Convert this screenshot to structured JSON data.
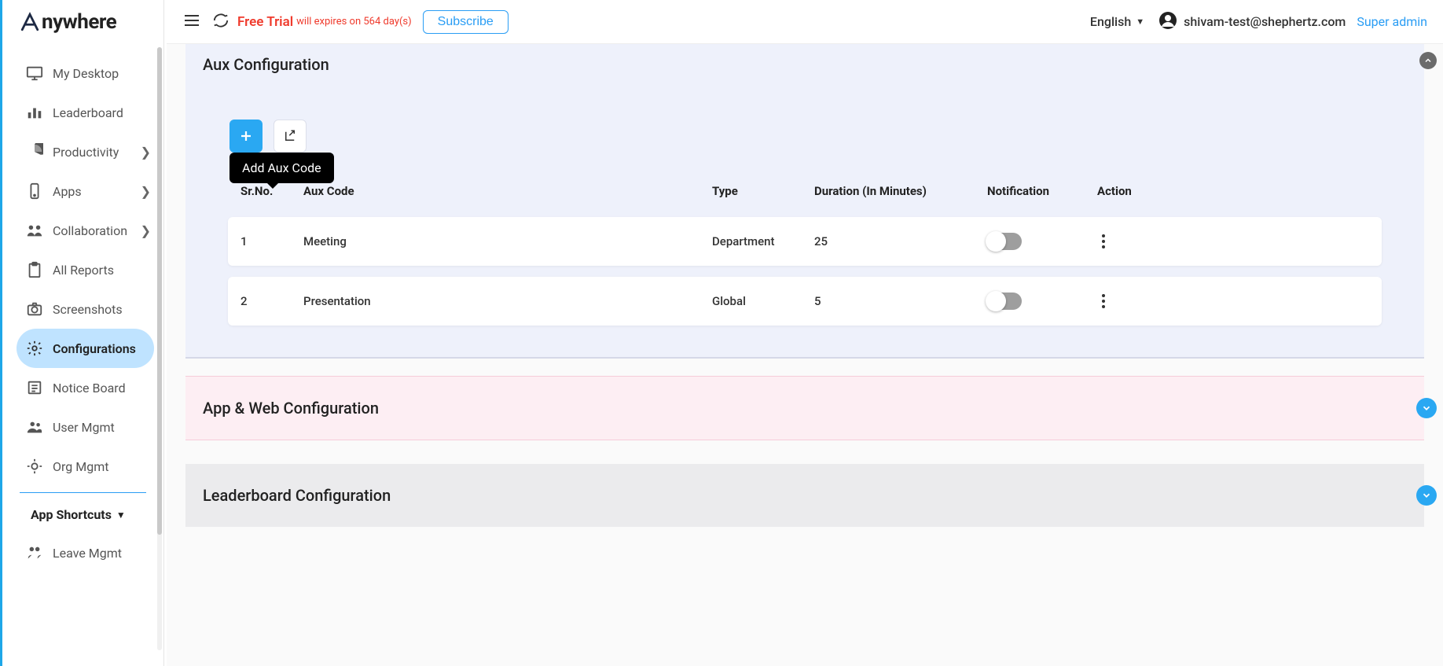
{
  "brand": "nywhere",
  "header": {
    "free_trial": "Free Trial",
    "expires": "will expires on 564 day(s)",
    "subscribe": "Subscribe",
    "language": "English",
    "user_email": "shivam-test@shephertz.com",
    "role": "Super admin"
  },
  "tooltip": {
    "add_aux": "Add Aux Code"
  },
  "sidebar": {
    "items": [
      {
        "label": "My Desktop",
        "icon": "desktop",
        "chev": false
      },
      {
        "label": "Leaderboard",
        "icon": "leaderboard",
        "chev": false
      },
      {
        "label": "Productivity",
        "icon": "pie",
        "chev": true
      },
      {
        "label": "Apps",
        "icon": "phone",
        "chev": true
      },
      {
        "label": "Collaboration",
        "icon": "collab",
        "chev": true
      },
      {
        "label": "All Reports",
        "icon": "clipboard",
        "chev": false
      },
      {
        "label": "Screenshots",
        "icon": "camera",
        "chev": false
      },
      {
        "label": "Configurations",
        "icon": "gear",
        "chev": false,
        "active": true
      },
      {
        "label": "Notice Board",
        "icon": "board",
        "chev": false
      },
      {
        "label": "User Mgmt",
        "icon": "users",
        "chev": false
      },
      {
        "label": "Org Mgmt",
        "icon": "org",
        "chev": false
      }
    ],
    "shortcut_title": "App Shortcuts",
    "leave": "Leave Mgmt"
  },
  "aux": {
    "title": "Aux Configuration",
    "columns": [
      "Sr.No.",
      "Aux Code",
      "Type",
      "Duration (In Minutes)",
      "Notification",
      "Action"
    ],
    "rows": [
      {
        "sr": "1",
        "code": "Meeting",
        "type": "Department",
        "duration": "25",
        "notify": false
      },
      {
        "sr": "2",
        "code": "Presentation",
        "type": "Global",
        "duration": "5",
        "notify": false
      }
    ]
  },
  "sections": {
    "app_web": "App & Web Configuration",
    "leaderboard": "Leaderboard Configuration"
  }
}
